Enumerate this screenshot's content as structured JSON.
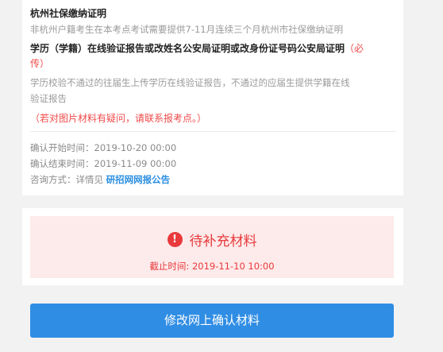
{
  "section1": {
    "title": "杭州社保缴纳证明",
    "desc": "非杭州户籍考生在本考点考试需要提供7-11月连续三个月杭州市社保缴纳证明"
  },
  "section2": {
    "title_part1": "学历（学籍）在线验证报告或改姓名公安局证明或改身份证号码公安局证明",
    "required_tag": "（必",
    "required_tag_cont": "传）",
    "title_line2_prefix": "",
    "desc_line1": "学历校验不通过的往届生上传学历在线验证报告，不通过的应届生提供学籍在线",
    "desc_line2": "验证报告"
  },
  "hint": "（若对图片材料有疑问，请联系报考点。）",
  "meta": {
    "start_label": "确认开始时间：",
    "start_value": "2019-10-20 00:00",
    "end_label": "确认结束时间：",
    "end_value": "2019-11-09 00:00",
    "contact_label": "咨询方式：",
    "contact_prefix": "详情见 ",
    "contact_link": "研招网网报公告"
  },
  "status": {
    "icon_glyph": "!",
    "icon_name": "exclamation-circle-icon",
    "text": "待补充材料",
    "deadline_label": "截止时间: ",
    "deadline_value": "2019-11-10 10:00",
    "color": "#e8393b"
  },
  "action": {
    "button_label": "修改网上确认材料",
    "button_color": "#2f8de4"
  }
}
